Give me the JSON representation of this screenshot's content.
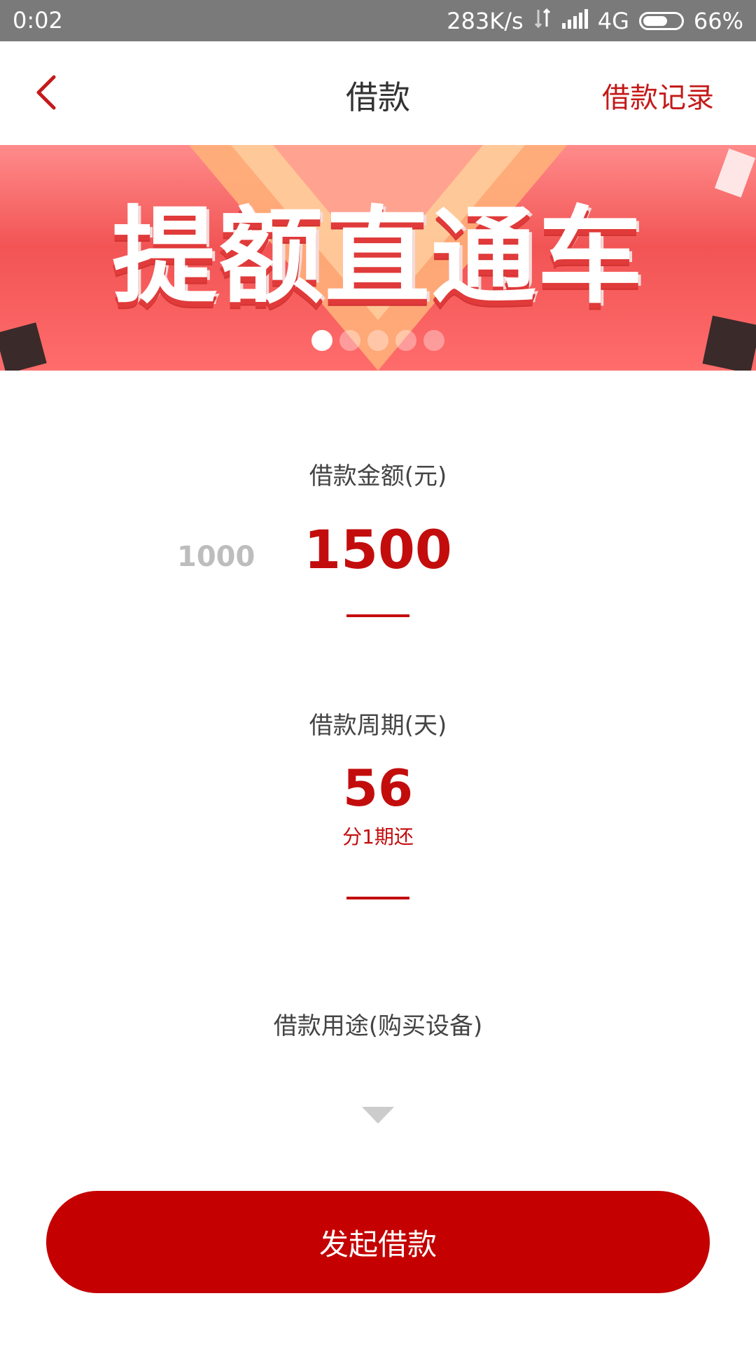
{
  "status_bar": {
    "time": "0:02",
    "net_speed": "283K/s",
    "network_type": "4G",
    "battery_text": "66%",
    "battery_level": 0.66
  },
  "header": {
    "title": "借款",
    "record_label": "借款记录",
    "back_icon": "chevron-left-icon",
    "accent_color": "#c41a1a"
  },
  "banner": {
    "text": "提额直通车",
    "dots_count": 5,
    "active_dot": 0
  },
  "amount": {
    "label": "借款金额(元)",
    "previous_value": "1000",
    "selected_value": "1500"
  },
  "period": {
    "label": "借款周期(天)",
    "selected_value": "56",
    "installment_text": "分1期还"
  },
  "purpose": {
    "label": "借款用途(购买设备)",
    "dropdown_icon": "caret-down-icon"
  },
  "submit": {
    "label": "发起借款",
    "color": "#c40000"
  }
}
